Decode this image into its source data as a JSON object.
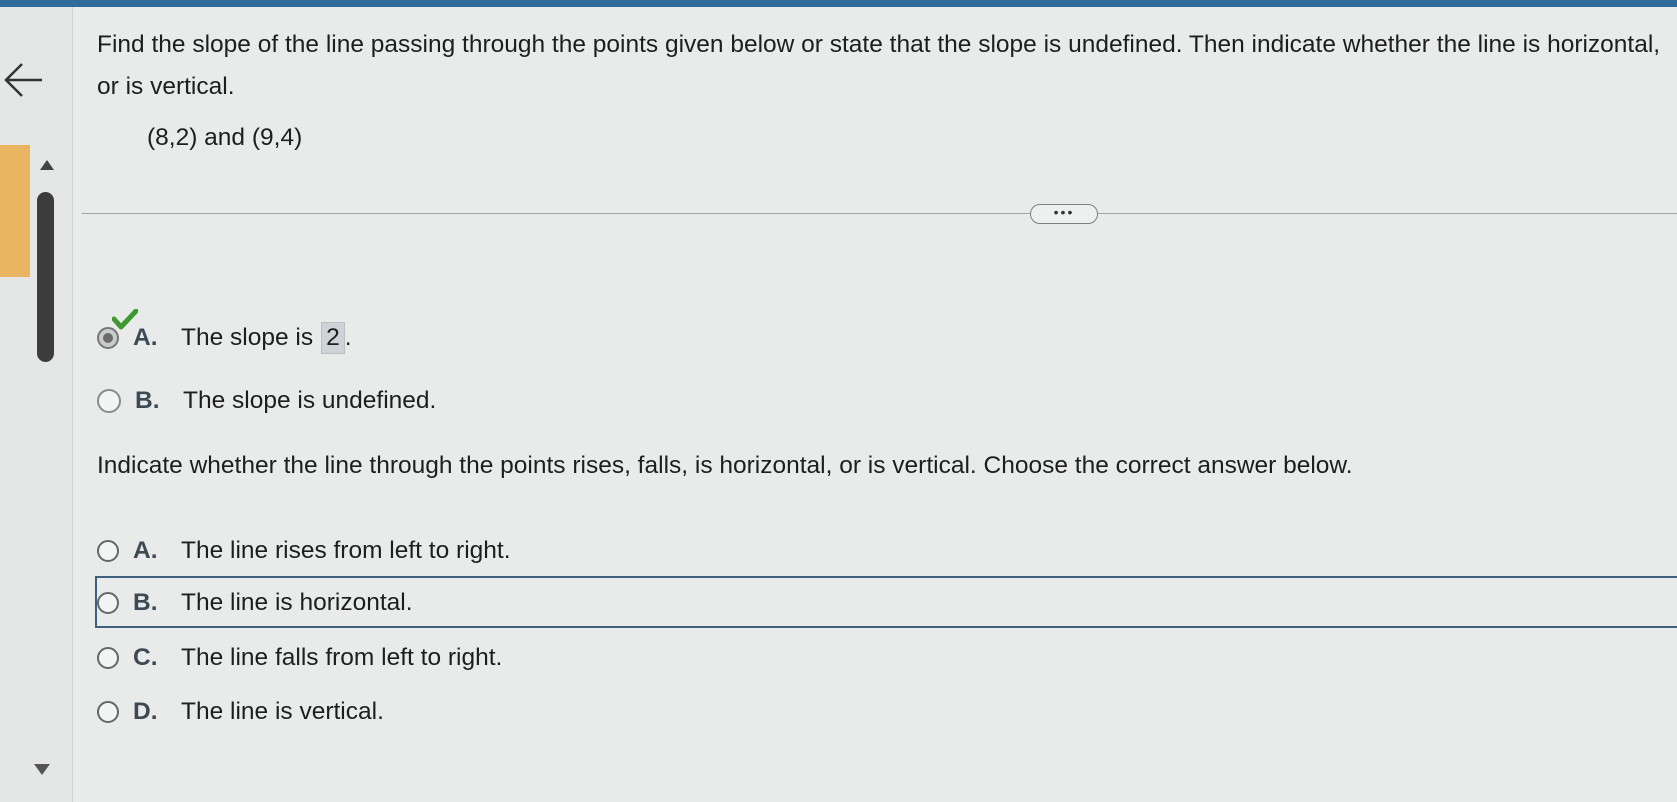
{
  "question": {
    "text": "Find the slope of the line passing through the points given below or state that the slope is undefined. Then indicate whether the line is horizontal, or is vertical.",
    "points": "(8,2) and (9,4)"
  },
  "more_label": "•••",
  "part1": {
    "options": [
      {
        "letter": "A.",
        "text_before": "The slope is",
        "answer": "2",
        "text_after": ".",
        "selected": true
      },
      {
        "letter": "B.",
        "text": "The slope is undefined.",
        "selected": false
      }
    ]
  },
  "part2": {
    "prompt": "Indicate whether the line through the points rises, falls, is horizontal, or is vertical. Choose the correct answer below.",
    "options": [
      {
        "letter": "A.",
        "text": "The line rises from left to right."
      },
      {
        "letter": "B.",
        "text": "The line is horizontal."
      },
      {
        "letter": "C.",
        "text": "The line falls from left to right."
      },
      {
        "letter": "D.",
        "text": "The line is vertical."
      }
    ]
  },
  "colors": {
    "top_bar": "#2f6b9a",
    "accent_orange": "#e9b560",
    "check_green": "#3e9a2f",
    "focus_frame": "#3f5f7c"
  },
  "icons": [
    "back-arrow-icon",
    "scroll-up-icon",
    "scroll-down-icon",
    "checkmark-icon"
  ]
}
